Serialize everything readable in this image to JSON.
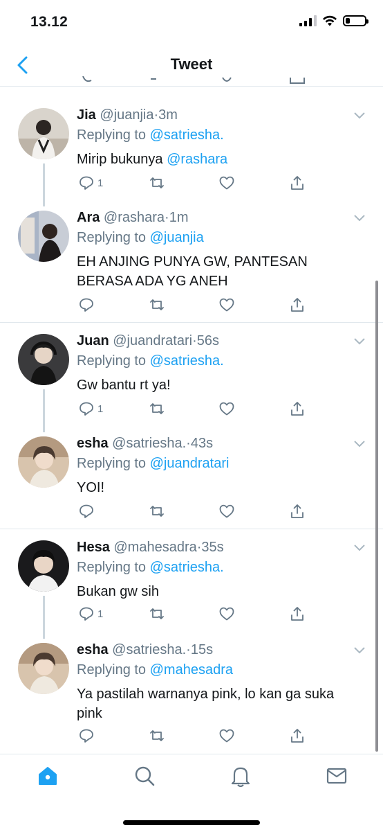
{
  "status_bar": {
    "time": "13.12"
  },
  "nav": {
    "title": "Tweet"
  },
  "tweets": [
    {
      "name": "Jia",
      "handle": "@juanjia",
      "dot": "·",
      "time": "3m",
      "replying_label": "Replying to",
      "replying_to": "@satriesha.",
      "text": "Mirip bukunya ",
      "text_mention": "@rashara",
      "reply_count": "1"
    },
    {
      "name": "Ara",
      "handle": "@rashara",
      "dot": "·",
      "time": "1m",
      "replying_label": "Replying to",
      "replying_to": "@juanjia",
      "text": "EH ANJING PUNYA GW, PANTESAN BERASA ADA YG ANEH",
      "reply_count": ""
    },
    {
      "name": "Juan",
      "handle": "@juandratari",
      "dot": "·",
      "time": "56s",
      "replying_label": "Replying to",
      "replying_to": "@satriesha.",
      "text": "Gw bantu rt ya!",
      "reply_count": "1"
    },
    {
      "name": "esha",
      "handle": "@satriesha.",
      "dot": "·",
      "time": "43s",
      "replying_label": "Replying to",
      "replying_to": "@juandratari",
      "text": "YOI!",
      "reply_count": ""
    },
    {
      "name": "Hesa",
      "handle": "@mahesadra",
      "dot": "·",
      "time": "35s",
      "replying_label": "Replying to",
      "replying_to": "@satriesha.",
      "text": "Bukan gw sih",
      "reply_count": "1"
    },
    {
      "name": "esha",
      "handle": "@satriesha.",
      "dot": "·",
      "time": "15s",
      "replying_label": "Replying to",
      "replying_to": "@mahesadra",
      "text": "Ya pastilah warnanya pink, lo kan ga suka pink",
      "reply_count": ""
    }
  ],
  "tab_bar": {
    "tabs": [
      {
        "icon": "home-icon",
        "active": true
      },
      {
        "icon": "search-icon",
        "active": false
      },
      {
        "icon": "bell-icon",
        "active": false
      },
      {
        "icon": "mail-icon",
        "active": false
      }
    ]
  },
  "colors": {
    "accent": "#1da1f2",
    "muted": "#657786",
    "text": "#14171a",
    "line": "#ccd6dd"
  }
}
